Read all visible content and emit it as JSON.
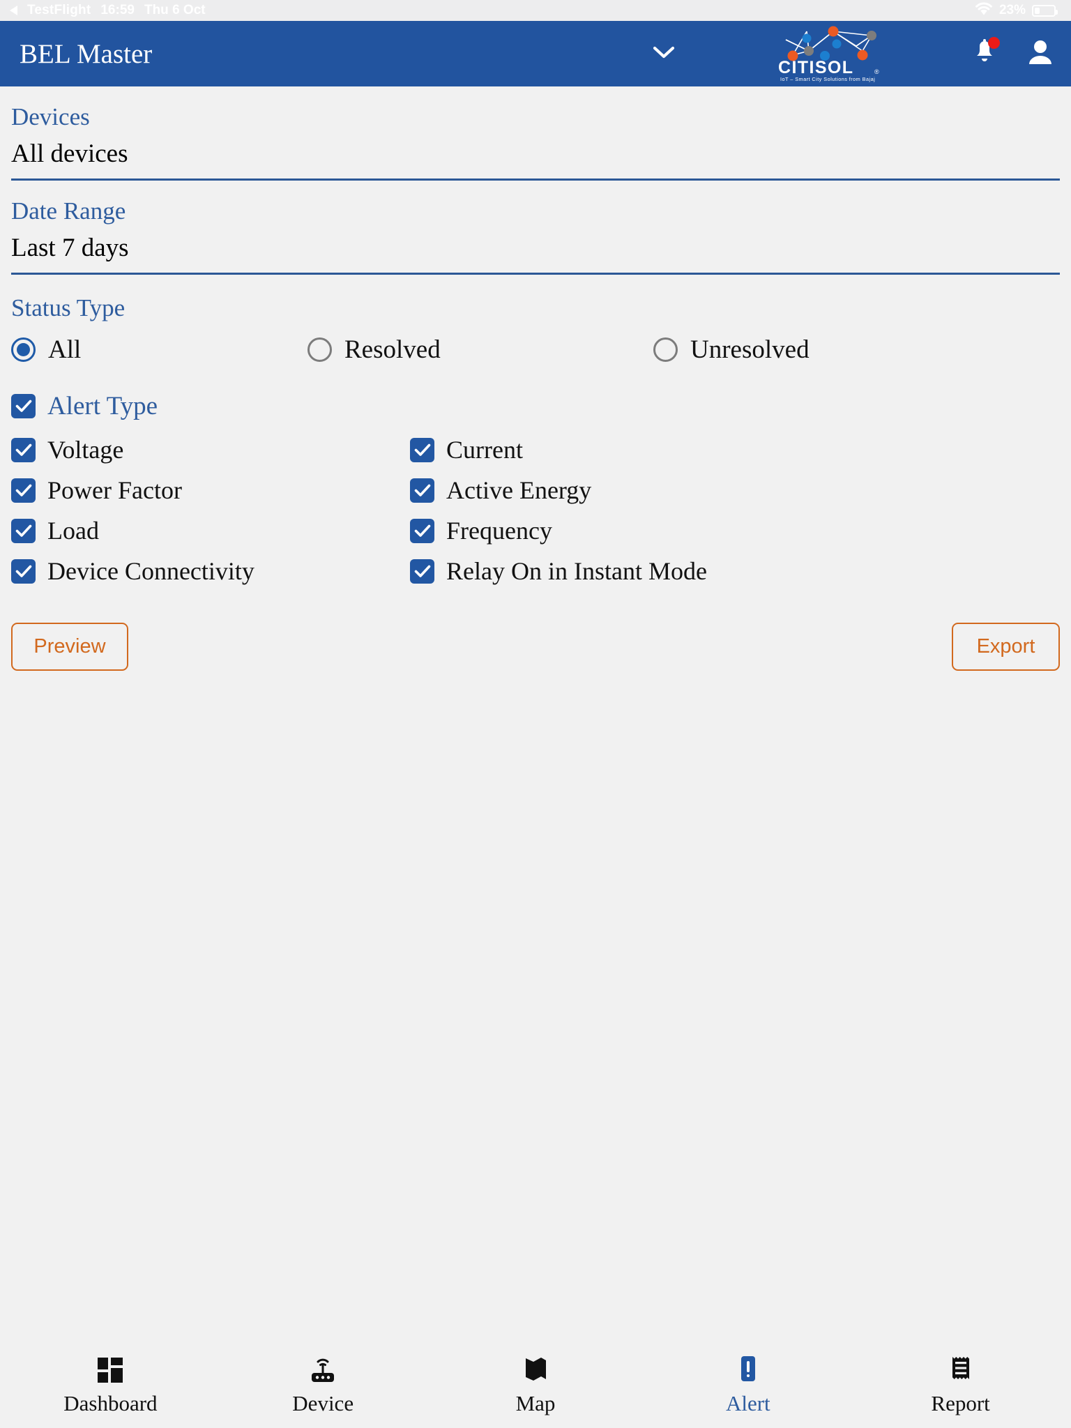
{
  "status_bar": {
    "back_label": "TestFlight",
    "time": "16:59",
    "date": "Thu 6 Oct",
    "battery_percent": "23%",
    "wifi_icon": "wifi-icon",
    "battery_icon": "battery-icon"
  },
  "app_bar": {
    "title": "BEL Master",
    "dropdown_icon": "chevron-down-icon",
    "logo_name": "CITISOL",
    "logo_registered": "®",
    "logo_tagline": "IoT – Smart City Solutions from Bajaj",
    "notifications_icon": "bell-icon",
    "account_icon": "person-icon",
    "bar_color": "#22549f",
    "badge_color": "#ea1b17"
  },
  "filters": {
    "devices": {
      "label": "Devices",
      "value": "All devices"
    },
    "date_range": {
      "label": "Date Range",
      "value": "Last 7 days"
    },
    "status_type": {
      "label": "Status Type",
      "options": [
        {
          "label": "All",
          "selected": true
        },
        {
          "label": "Resolved",
          "selected": false
        },
        {
          "label": "Unresolved",
          "selected": false
        }
      ]
    },
    "alert_type": {
      "label": "Alert Type",
      "checked": true,
      "rows": [
        [
          {
            "label": "Voltage",
            "checked": true
          },
          {
            "label": "Current",
            "checked": true
          }
        ],
        [
          {
            "label": "Power Factor",
            "checked": true
          },
          {
            "label": "Active Energy",
            "checked": true
          }
        ],
        [
          {
            "label": "Load",
            "checked": true
          },
          {
            "label": "Frequency",
            "checked": true
          }
        ],
        [
          {
            "label": "Device Connectivity",
            "checked": true
          },
          {
            "label": "Relay On in Instant Mode",
            "checked": true
          }
        ]
      ]
    }
  },
  "actions": {
    "preview_label": "Preview",
    "export_label": "Export",
    "accent_color": "#d2691e"
  },
  "bottom_nav": {
    "active_color": "#2e5c9e",
    "items": [
      {
        "label": "Dashboard",
        "icon": "dashboard-grid-icon",
        "active": false
      },
      {
        "label": "Device",
        "icon": "router-wifi-icon",
        "active": false
      },
      {
        "label": "Map",
        "icon": "map-icon",
        "active": false
      },
      {
        "label": "Alert",
        "icon": "alert-exclamation-icon",
        "active": true
      },
      {
        "label": "Report",
        "icon": "receipt-icon",
        "active": false
      }
    ]
  }
}
